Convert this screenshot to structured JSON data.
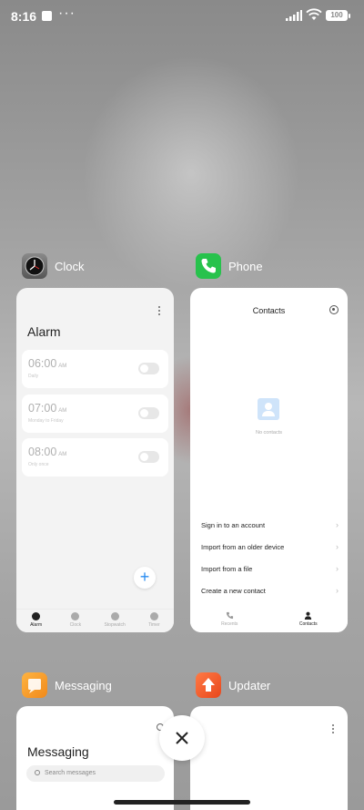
{
  "status_bar": {
    "time": "8:16",
    "overflow": "···",
    "battery": "100"
  },
  "apps": {
    "clock": {
      "name": "Clock",
      "title": "Alarm",
      "alarms": [
        {
          "time": "06:00",
          "ampm": "AM",
          "sub": "Daily",
          "on": false
        },
        {
          "time": "07:00",
          "ampm": "AM",
          "sub": "Monday to Friday",
          "on": false
        },
        {
          "time": "08:00",
          "ampm": "AM",
          "sub": "Only once",
          "on": false
        }
      ],
      "fab": "+",
      "tabs": [
        "Alarm",
        "Clock",
        "Stopwatch",
        "Timer"
      ],
      "active_tab": "Alarm"
    },
    "phone": {
      "name": "Phone",
      "title": "Contacts",
      "empty": "No contacts",
      "options": [
        "Sign in to an account",
        "Import from an older device",
        "Import from a file",
        "Create a new contact"
      ],
      "tabs": [
        "Recents",
        "Contacts"
      ],
      "active_tab": "Contacts"
    },
    "messaging": {
      "name": "Messaging",
      "title": "Messaging",
      "search_placeholder": "Search messages"
    },
    "updater": {
      "name": "Updater"
    }
  },
  "colors": {
    "accent": "#2a8cf0",
    "phone_icon": "#27c24c",
    "messaging_icon": "#f5a623",
    "updater_icon": "#f05a28"
  },
  "icons": [
    "clock-icon",
    "phone-icon",
    "messaging-icon",
    "updater-icon",
    "close-icon",
    "gear-icon",
    "search-icon"
  ]
}
